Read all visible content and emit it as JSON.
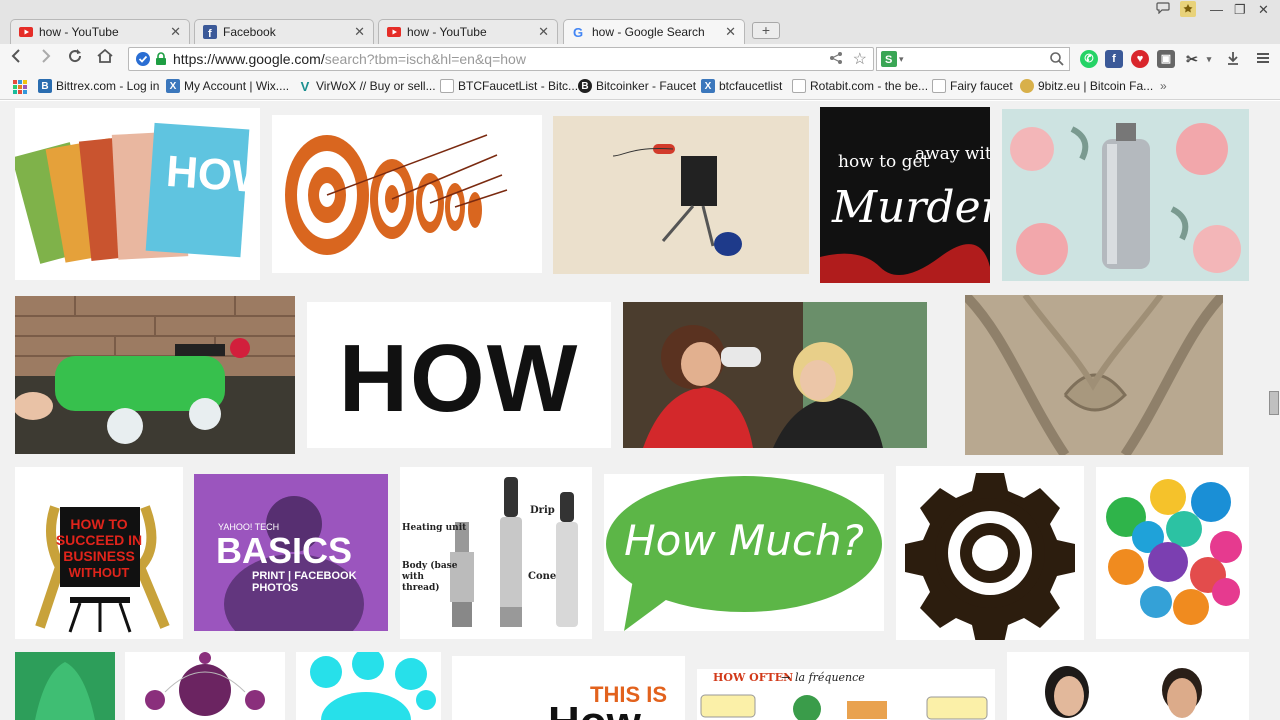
{
  "tabs": [
    {
      "title": "how - YouTube",
      "icon": "youtube-icon"
    },
    {
      "title": "Facebook",
      "icon": "facebook-icon"
    },
    {
      "title": "how - YouTube",
      "icon": "youtube-icon"
    },
    {
      "title": "how - Google Search",
      "icon": "google-icon"
    }
  ],
  "omnibox": {
    "host": "https://www.google.com/",
    "path": "search?tbm=isch&hl=en&q=how"
  },
  "bookmarks": [
    {
      "label": "Bittrex.com - Log in",
      "icon": "B",
      "color": "#2a6db0"
    },
    {
      "label": "My Account | Wix....",
      "icon": "X",
      "color": "#3b77bc"
    },
    {
      "label": "VirWoX // Buy or sell...",
      "icon": "V",
      "color": "#1a8f8f"
    },
    {
      "label": "BTCFaucetList - Bitc...",
      "icon": "page",
      "color": "#999"
    },
    {
      "label": "Bitcoinker - Faucet",
      "icon": "B",
      "color": "#222"
    },
    {
      "label": "btcfaucetlist",
      "icon": "X",
      "color": "#3b77bc"
    },
    {
      "label": "Rotabit.com - the be...",
      "icon": "page",
      "color": "#999"
    },
    {
      "label": "Fairy faucet",
      "icon": "page",
      "color": "#999"
    },
    {
      "label": "9bitz.eu | Bitcoin Fa...",
      "icon": "coin",
      "color": "#d8b04a"
    }
  ],
  "images": {
    "how_text": "HOW",
    "murder_line1": "how to get",
    "murder_line2": "away with",
    "murder_line3": "Murder",
    "business_text": "\"HOW TO SUCCEED IN BUSINESS WITHOUT REALLY TRYING\"",
    "yahoo_tech": "YAHOO! TECH",
    "basics": "BASICS",
    "basics_sub": "PRINT | FACEBOOK PHOTOS",
    "label_heating": "Heating unit",
    "label_drip": "Drip",
    "label_body": "Body (base with thread)",
    "label_cone": "Cone",
    "how_much": "How Much?",
    "this_is": "THIS IS",
    "how_big": "How",
    "how_often": "HOW OFTEN",
    "la_frequence": "la fréquence"
  },
  "colors": {
    "accent": "#4285f4",
    "speech_green": "#5cb647",
    "basics_purple": "#9a4fbd"
  }
}
